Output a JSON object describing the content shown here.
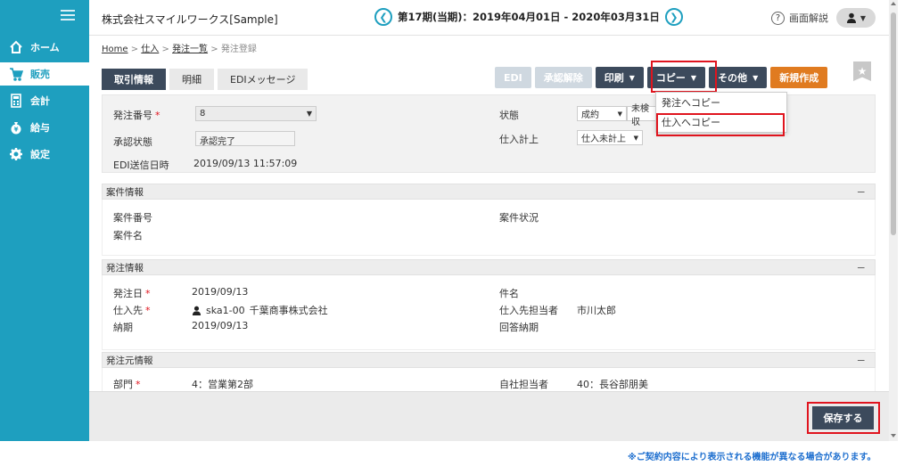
{
  "sidebar": {
    "items": [
      {
        "label": "ホーム",
        "icon": "home-icon"
      },
      {
        "label": "販売",
        "icon": "cart-icon"
      },
      {
        "label": "会計",
        "icon": "calculator-icon"
      },
      {
        "label": "給与",
        "icon": "money-bag-icon"
      },
      {
        "label": "設定",
        "icon": "gear-icon"
      }
    ],
    "active_index": 1,
    "color": "#1e9fbf"
  },
  "header": {
    "company": "株式会社スマイルワークス[Sample]",
    "period": "第17期(当期)：2019年04月01日 - 2020年03月31日",
    "help_label": "画面解説"
  },
  "breadcrumb": {
    "home": "Home",
    "sep": ">",
    "shiire": "仕入",
    "list": "発注一覧",
    "current": "発注登録"
  },
  "tabs": [
    "取引情報",
    "明細",
    "EDIメッセージ"
  ],
  "actions": {
    "edi": "EDI",
    "unapprove": "承認解除",
    "print": "印刷",
    "copy": "コピー",
    "other": "その他",
    "new": "新規作成"
  },
  "copy_menu": [
    "発注へコピー",
    "仕入へコピー"
  ],
  "order": {
    "number_label": "発注番号",
    "number_value": "8",
    "approval_label": "承認状態",
    "approval_value": "承認完了",
    "edi_label": "EDI送信日時",
    "edi_value": "2019/09/13 11:57:09",
    "status_label": "状態",
    "status_value": "成約",
    "status_value2": "未検収",
    "purchase_label": "仕入計上",
    "purchase_value": "仕入未計上"
  },
  "project": {
    "title": "案件情報",
    "number_label": "案件番号",
    "name_label": "案件名",
    "status_label": "案件状況"
  },
  "order_info": {
    "title": "発注情報",
    "date_label": "発注日",
    "date_value": "2019/09/13",
    "supplier_label": "仕入先",
    "supplier_code": "ska1-00",
    "supplier_name": "千葉商事株式会社",
    "due_label": "納期",
    "due_value": "2019/09/13",
    "subject_label": "件名",
    "contact_label": "仕入先担当者",
    "contact_value": "市川太郎",
    "reply_label": "回答納期"
  },
  "source_info": {
    "title": "発注元情報",
    "dept_label": "部門",
    "dept_value": "4：営業第2部",
    "staff_label": "自社担当者",
    "staff_value": "40：長谷部朋美"
  },
  "section_collapse": "－",
  "required_mark": "*",
  "save_label": "保存する",
  "notice": "※ご契約内容により表示される機能が異なる場合があります。"
}
